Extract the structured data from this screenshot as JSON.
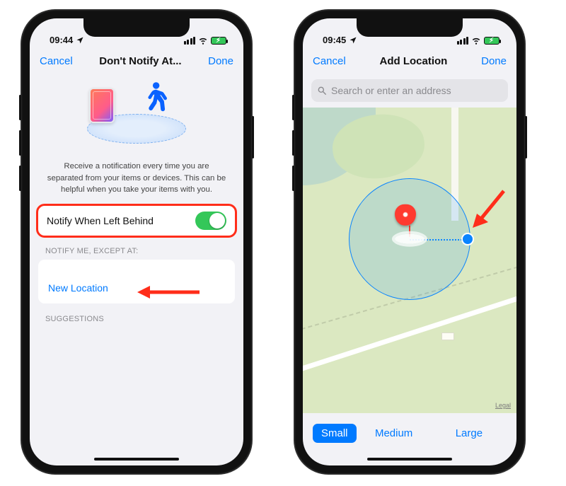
{
  "left": {
    "status": {
      "time": "09:44"
    },
    "nav": {
      "cancel": "Cancel",
      "title": "Don't Notify At...",
      "done": "Done"
    },
    "description": "Receive a notification every time you are separated from your items or devices. This can be helpful when you take your items with you.",
    "toggle": {
      "label": "Notify When Left Behind",
      "on": true
    },
    "except_header": "NOTIFY ME, EXCEPT AT:",
    "new_location": "New Location",
    "suggestions_header": "SUGGESTIONS"
  },
  "right": {
    "status": {
      "time": "09:45"
    },
    "nav": {
      "cancel": "Cancel",
      "title": "Add Location",
      "done": "Done"
    },
    "search": {
      "placeholder": "Search or enter an address"
    },
    "legal": "Legal",
    "radius": {
      "options": [
        "Small",
        "Medium",
        "Large"
      ],
      "selected": "Small"
    }
  }
}
